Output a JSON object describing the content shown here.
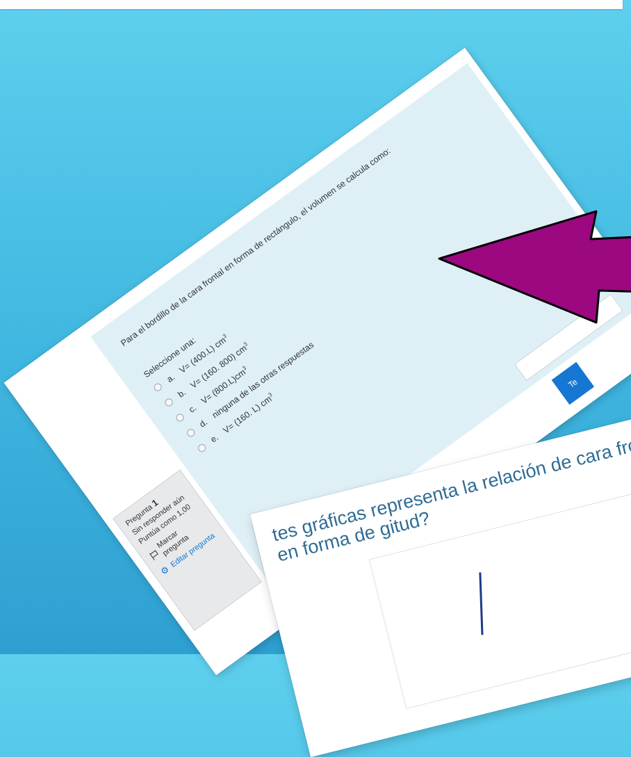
{
  "colors": {
    "background_top": "#5ed0ee",
    "background_bottom": "#2e9fd1",
    "arrow_fill": "#9b087f",
    "accent_blue": "#1677d2",
    "question_bg": "#def0f6"
  },
  "question1": {
    "info": {
      "label": "Pregunta",
      "number": "1",
      "status": "Sin responder aún",
      "score": "Puntúa como 1,00",
      "flag_label": "Marcar pregunta",
      "edit_label": "Editar pregunta"
    },
    "text": "Para el bordillo de la cara frontal en forma de rectángulo, el volumen se calcula como:",
    "select_label": "Seleccione una:",
    "options": [
      {
        "prefix": "a.",
        "text": "V= (400.L) cm",
        "sup": "3"
      },
      {
        "prefix": "b.",
        "text": "V= (160. 800) cm",
        "sup": "3"
      },
      {
        "prefix": "c.",
        "text": "V= (800.L)cm",
        "sup": "3"
      },
      {
        "prefix": "d.",
        "text": "ninguna de las otras respuestas",
        "sup": ""
      },
      {
        "prefix": "e.",
        "text": "V= (160. L) cm",
        "sup": "3"
      }
    ],
    "side_tab_label": "Te"
  },
  "question2_preview": {
    "text": "tes gráficas representa la relación de cara frontal en forma de gitud?"
  },
  "icons": {
    "flag": "flag-icon",
    "edit": "gear-icon",
    "arrow": "arrow-left-icon"
  }
}
